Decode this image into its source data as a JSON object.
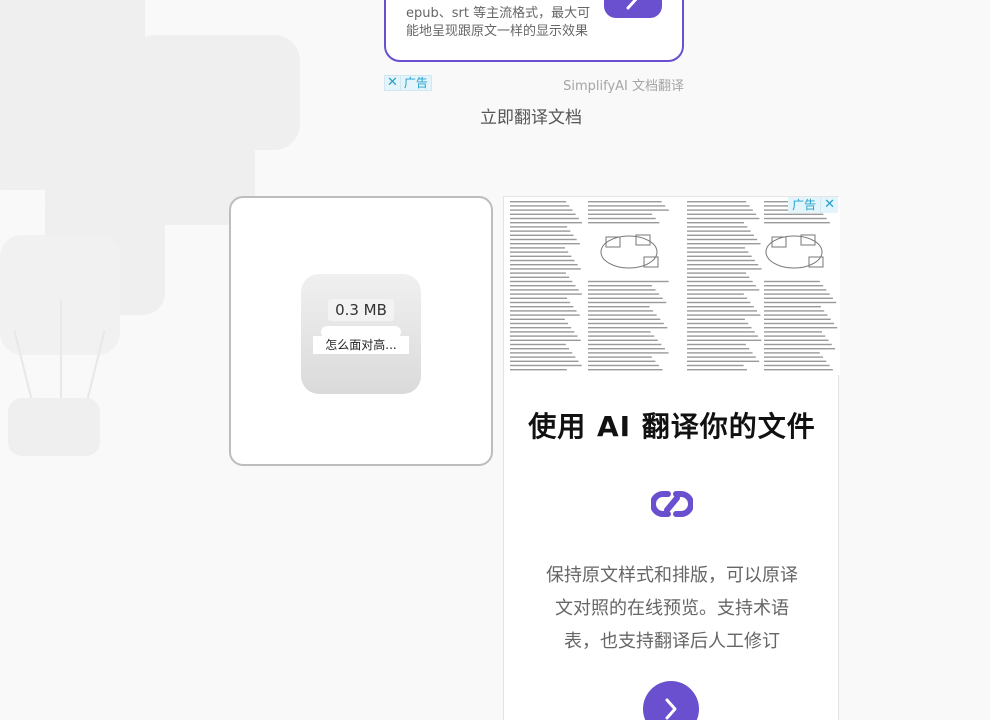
{
  "top_ad": {
    "text": "epub、srt 等主流格式，最大可能地呈现跟原文一样的显示效果",
    "go_icon": "chevron-right-icon",
    "badge_label": "广告",
    "source": "SimplifyAI 文档翻译"
  },
  "translate_link": "立即翻译文档",
  "file_card": {
    "size": "0.3 MB",
    "name": "怎么面对高..."
  },
  "ad_card": {
    "badge_label": "广告",
    "headline": "使用 AI 翻译你的文件",
    "logo_icon": "link-logo-icon",
    "description": "保持原文样式和排版，可以原译文对照的在线预览。支持术语表，也支持翻译后人工修订",
    "go_icon": "chevron-right-icon"
  },
  "colors": {
    "accent": "#6a4fce",
    "ad_badge": "#23a0c9",
    "background": "#f9f9f9"
  }
}
